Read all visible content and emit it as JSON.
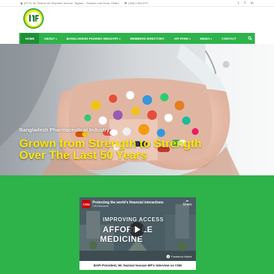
{
  "topbar": {
    "address": "(PCO) 38, Shaheb Ali Shaheber Avenue, Tejgaon - Gulshan Link Road, Dhaka",
    "phone": "(+88)-2-9614797",
    "social": [
      "twitter-icon",
      "facebook-icon",
      "linkedin-icon"
    ]
  },
  "nav": {
    "items": [
      {
        "label": "HOME",
        "caret": false
      },
      {
        "label": "ABOUT",
        "caret": true
      },
      {
        "label": "BANGLADESH PHARMA INDUSTRY",
        "caret": true
      },
      {
        "label": "MEMBERS DIRECTORY",
        "caret": false
      },
      {
        "label": "API PARK",
        "caret": true
      },
      {
        "label": "MEDIA",
        "caret": true
      },
      {
        "label": "CONTACT",
        "caret": false
      }
    ]
  },
  "hero": {
    "kicker": "Bangladesh Pharmaceutical Industry",
    "headline_line1": "Grown from Strength to Strength",
    "headline_line2": "Over The Last 50 Years"
  },
  "video": {
    "channel_badge": "CNN",
    "title": "Protecting the world's financial interactions",
    "subtitle": "CNN Business",
    "share_label": "Share",
    "overlay_line1": "IMPROVING ACCESS",
    "overlay_line2": "AFFORD   LE",
    "overlay_line3": "MEDICINE",
    "watch_label": "Facebook Watch",
    "caption": "BAPI President, Mr. Nazmul Hassan MP's Interview on CNN"
  },
  "colors": {
    "brand_green": "#2db34a",
    "nav_active": "#1e8f36",
    "headline_yellow": "#ffe600"
  }
}
